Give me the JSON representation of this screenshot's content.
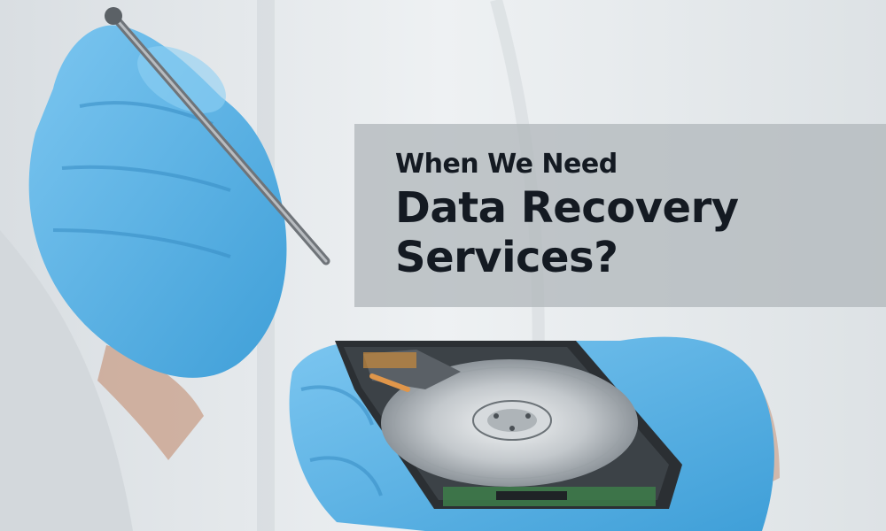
{
  "headline": {
    "line1": "When We Need",
    "line2": "Data Recovery",
    "line3": "Services?"
  },
  "image": {
    "subject": "gloved-hands-holding-opened-hard-drive-with-tool"
  },
  "colors": {
    "banner": "#b2b8bc",
    "text": "#141a22",
    "glove": "#62b6e8",
    "platter": "#c8ccd0"
  }
}
